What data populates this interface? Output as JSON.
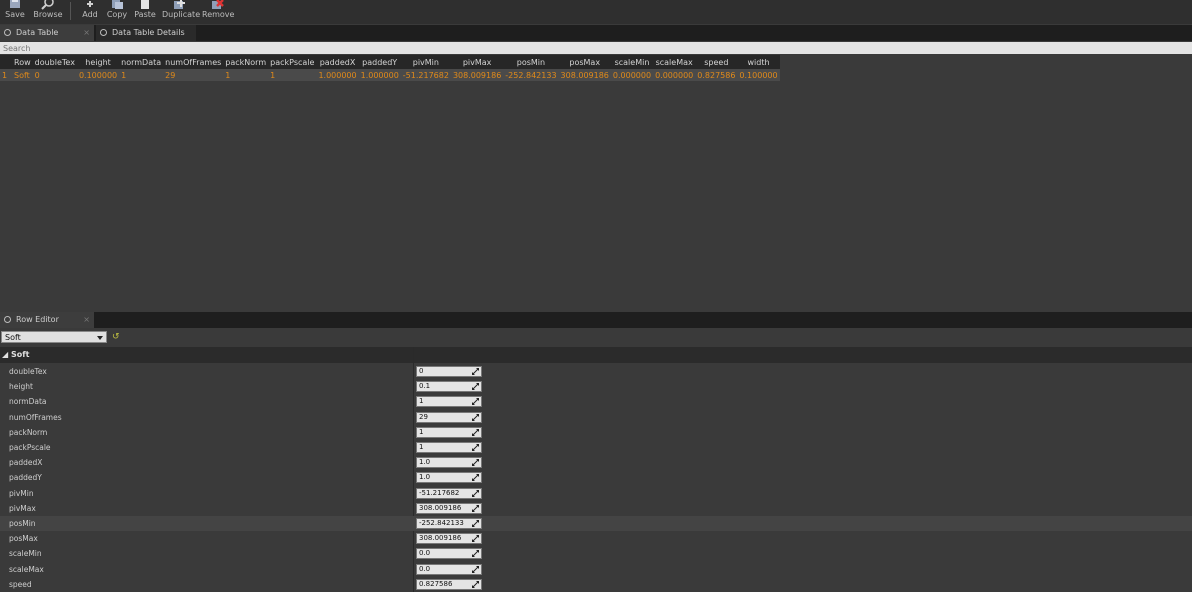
{
  "toolbar": {
    "save": "Save",
    "browse": "Browse",
    "add": "Add",
    "copy": "Copy",
    "paste": "Paste",
    "duplicate": "Duplicate",
    "remove": "Remove"
  },
  "tabs": {
    "data_table": "Data Table",
    "data_table_details": "Data Table Details"
  },
  "search": {
    "placeholder": "Search"
  },
  "table": {
    "headers": [
      "Row",
      "doubleTex",
      "height",
      "normData",
      "numOfFrames",
      "packNorm",
      "packPscale",
      "paddedX",
      "paddedY",
      "pivMin",
      "pivMax",
      "posMin",
      "posMax",
      "scaleMin",
      "scaleMax",
      "speed",
      "width"
    ],
    "rows": [
      {
        "index": "1",
        "cells": [
          "Soft",
          "0",
          "0.100000",
          "1",
          "29",
          "1",
          "1",
          "1.000000",
          "1.000000",
          "-51.217682",
          "308.009186",
          "-252.842133",
          "308.009186",
          "0.000000",
          "0.000000",
          "0.827586",
          "0.100000"
        ]
      }
    ]
  },
  "row_editor": {
    "tab_label": "Row Editor",
    "selected_row": "Soft",
    "category": "Soft",
    "properties": [
      {
        "name": "doubleTex",
        "value": "0"
      },
      {
        "name": "height",
        "value": "0.1"
      },
      {
        "name": "normData",
        "value": "1"
      },
      {
        "name": "numOfFrames",
        "value": "29"
      },
      {
        "name": "packNorm",
        "value": "1"
      },
      {
        "name": "packPscale",
        "value": "1"
      },
      {
        "name": "paddedX",
        "value": "1.0"
      },
      {
        "name": "paddedY",
        "value": "1.0"
      },
      {
        "name": "pivMin",
        "value": "-51.217682"
      },
      {
        "name": "pivMax",
        "value": "308.009186"
      },
      {
        "name": "posMin",
        "value": "-252.842133"
      },
      {
        "name": "posMax",
        "value": "308.009186"
      },
      {
        "name": "scaleMin",
        "value": "0.0"
      },
      {
        "name": "scaleMax",
        "value": "0.0"
      },
      {
        "name": "speed",
        "value": "0.827586"
      }
    ]
  },
  "colors": {
    "accent_orange": "#e08a1a",
    "panel_bg": "#3a3a3a",
    "header_bg": "#272727"
  }
}
